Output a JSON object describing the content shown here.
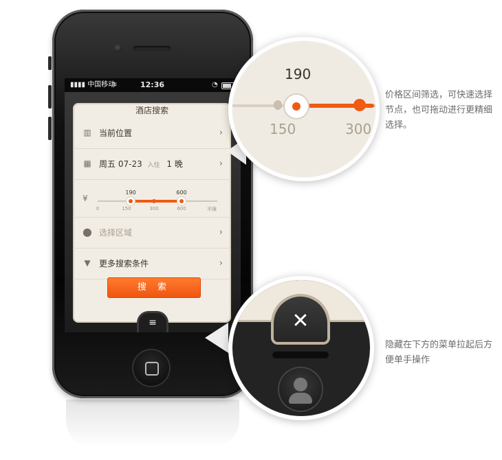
{
  "statusbar": {
    "carrier": "中国移动",
    "time": "12:36"
  },
  "card": {
    "title": "酒店搜索",
    "location": "当前位置",
    "date": {
      "weekday": "周五",
      "date": "07-23",
      "checkin_label": "入住",
      "nights": "1 晚"
    },
    "price": {
      "symbol": "¥",
      "low_value": "190",
      "high_value": "600",
      "ticks": [
        "0",
        "150",
        "300",
        "600",
        "不限"
      ]
    },
    "area_placeholder": "选择区域",
    "more_conditions": "更多搜索条件",
    "search_button": "搜 索"
  },
  "zoom_slider": {
    "value": "190",
    "tick_left": "150",
    "tick_right": "300"
  },
  "captions": {
    "slider": "价格区间筛选，可快速选择节点，也可拖动进行更精细选择。",
    "menu": "隐藏在下方的菜单拉起后方便单手操作"
  },
  "colors": {
    "accent": "#f05a12",
    "card_bg": "#f2ede4"
  }
}
